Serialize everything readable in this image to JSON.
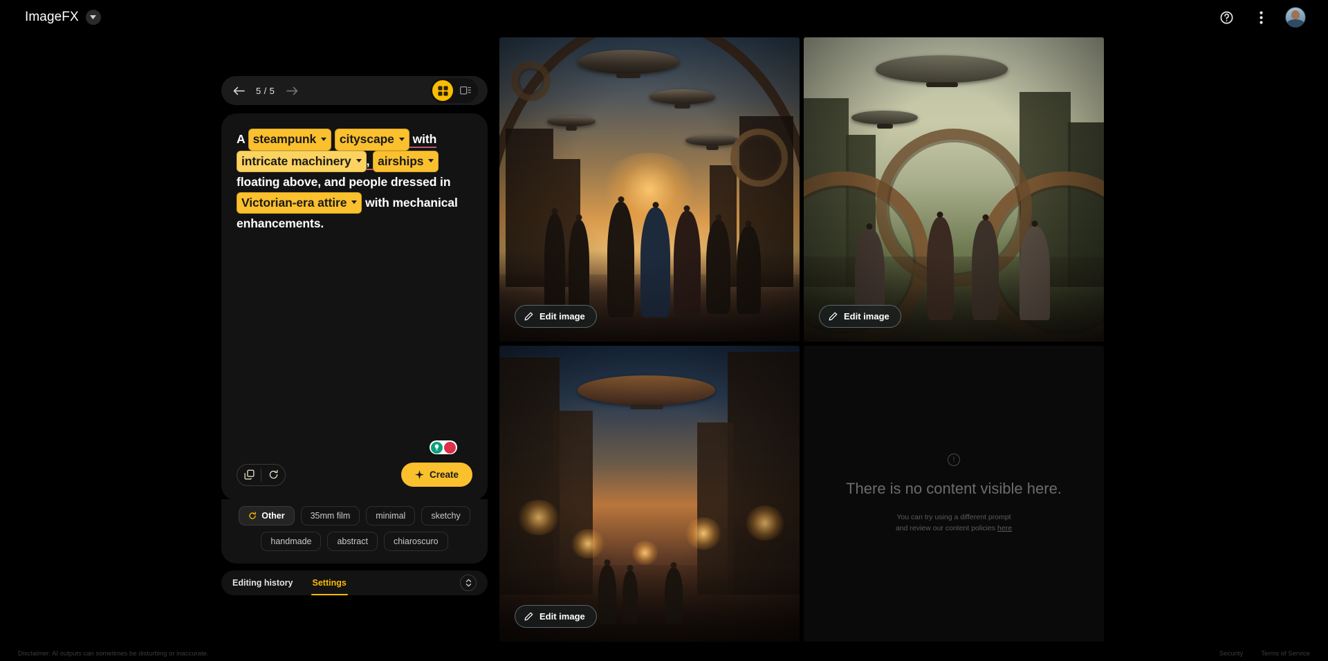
{
  "header": {
    "brand_title": "ImageFX",
    "brand_caret_icon": "chevron-down-icon",
    "help_icon": "help-circle-icon",
    "more_icon": "more-vertical-icon",
    "avatar_icon": "user-avatar"
  },
  "nav": {
    "back_icon": "arrow-left-icon",
    "forward_icon": "arrow-right-icon",
    "counter": "5 / 5",
    "view_grid_icon": "grid-view-icon",
    "view_detail_icon": "detail-view-icon",
    "active_view": "grid"
  },
  "prompt": {
    "segments": [
      {
        "type": "text",
        "value": "A "
      },
      {
        "type": "chip",
        "value": "steampunk",
        "style": "solid"
      },
      {
        "type": "text",
        "value": " "
      },
      {
        "type": "chip",
        "value": "cityscape",
        "style": "solid"
      },
      {
        "type": "text",
        "value": " with "
      },
      {
        "type": "chip",
        "value": "intricate machinery",
        "style": "lite"
      },
      {
        "type": "text",
        "value": ", "
      },
      {
        "type": "chip",
        "value": "airships",
        "style": "solid"
      },
      {
        "type": "text",
        "value": " floating above, and people dressed in "
      },
      {
        "type": "chip",
        "value": "Victorian-era attire",
        "style": "solid"
      },
      {
        "type": "text",
        "value": " with mechanical enhancements."
      }
    ],
    "full_text": "A steampunk cityscape with intricate machinery, airships floating above, and people dressed in Victorian-era attire with mechanical enhancements."
  },
  "prompt_tools": {
    "copy_icon": "copy-icon",
    "refresh_icon": "refresh-icon",
    "create_label": "Create",
    "create_icon": "sparkle-icon",
    "toggle_left_icon": "lightbulb-icon",
    "toggle_right_icon": "blob-icon"
  },
  "style_chips": [
    {
      "label": "Other",
      "selected": true,
      "icon": "refresh-icon"
    },
    {
      "label": "35mm film",
      "selected": false
    },
    {
      "label": "minimal",
      "selected": false
    },
    {
      "label": "sketchy",
      "selected": false
    },
    {
      "label": "handmade",
      "selected": false
    },
    {
      "label": "abstract",
      "selected": false
    },
    {
      "label": "chiaroscuro",
      "selected": false
    }
  ],
  "bottom_tabs": {
    "tabs": [
      {
        "label": "Editing history",
        "active": false
      },
      {
        "label": "Settings",
        "active": true
      }
    ],
    "expander_icon": "expand-collapse-icon"
  },
  "gallery": {
    "tiles": [
      {
        "id": "tile-1",
        "alt": "Steampunk cityscape at golden sunset with airships and Victorian crowd on a bridge",
        "edit_label": "Edit image",
        "edit_icon": "pencil-icon",
        "has_image": true
      },
      {
        "id": "tile-2",
        "alt": "Steampunk city with large gears, zeppelins and pale green sky",
        "edit_label": "Edit image",
        "edit_icon": "pencil-icon",
        "has_image": true
      },
      {
        "id": "tile-3",
        "alt": "Steampunk street at dusk lit by lanterns with an airship overhead",
        "edit_label": "Edit image",
        "edit_icon": "pencil-icon",
        "has_image": true
      },
      {
        "id": "tile-4",
        "alt": "Blocked content placeholder",
        "has_image": false
      }
    ]
  },
  "empty_state": {
    "icon": "alert-circle-icon",
    "title": "There is no content visible here.",
    "line1": "You can try using a different prompt",
    "line2_prefix": "and review our content policies ",
    "link_label": "here"
  },
  "footer": {
    "disclaimer": "Disclaimer: AI outputs can sometimes be disturbing or inaccurate.",
    "security_label": "Security",
    "terms_label": "Terms of Service"
  },
  "colors": {
    "accent": "#fbbc04",
    "chip": "#fbc02d",
    "chip_lite": "#fcd35f",
    "bg": "#000000",
    "panel": "#131313"
  }
}
